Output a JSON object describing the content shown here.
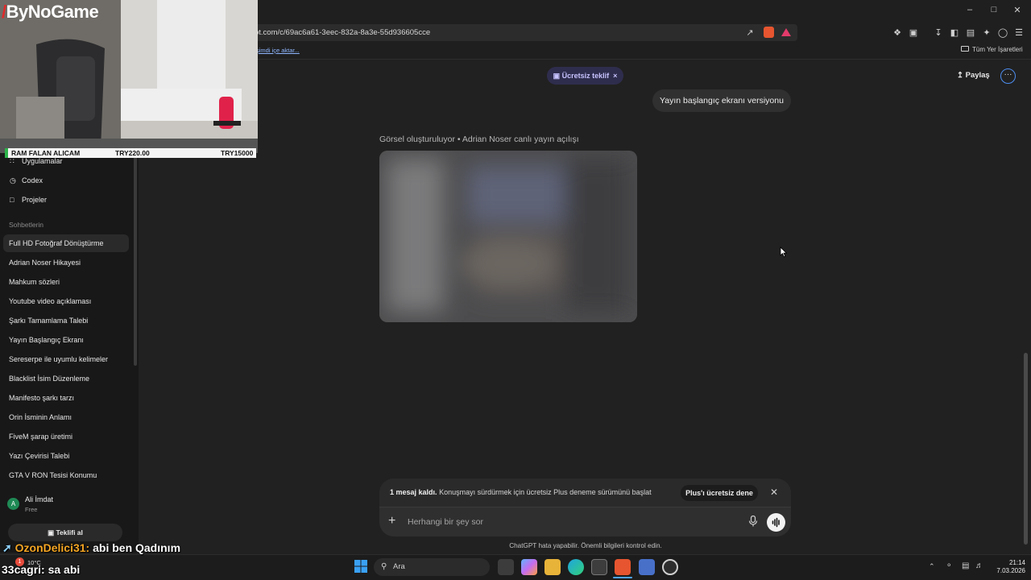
{
  "browser": {
    "url": "pt.com/c/69ac6a61-3eec-832a-8a3e-55d936605cce",
    "bookmark_import": "şimdi içe aktar...",
    "bookmarks_all": "Tüm Yer İşaretleri"
  },
  "webcam_overlay": {
    "brand": "ByNoGame",
    "ticker": {
      "label": "RAM FALAN ALICAM",
      "current": "TRY220.00",
      "goal": "TRY15000"
    }
  },
  "sidebar": {
    "nav": [
      {
        "label": "Uygulamalar",
        "icon": "apps-icon"
      },
      {
        "label": "Codex",
        "icon": "codex-icon"
      },
      {
        "label": "Projeler",
        "icon": "folder-icon"
      }
    ],
    "chats_heading": "Sohbetlerin",
    "chats": [
      "Full HD Fotoğraf Dönüştürme",
      "Adrian Noser Hikayesi",
      "Mahkum sözleri",
      "Youtube video açıklaması",
      "Şarkı Tamamlama Talebi",
      "Yayın Başlangıç Ekranı",
      "Sereserpe ile uyumlu kelimeler",
      "Blacklist İsim Düzenleme",
      "Manifesto şarkı tarzı",
      "Orin İsminin Anlamı",
      "FiveM şarap üretimi",
      "Yazı Çevirisi Talebi",
      "GTA V RON Tesisi Konumu"
    ],
    "active_chat_index": 0,
    "user": {
      "initial": "A",
      "name": "Ali İmdat",
      "plan": "Free"
    },
    "offer_button": "Teklifi al"
  },
  "header": {
    "offer_pill": "Ücretsiz teklif",
    "share": "Paylaş"
  },
  "conversation": {
    "user_message": "Yayın başlangıç ekranı versiyonu",
    "status": "Görsel oluşturuluyor • Adrian Noser canlı yayın açılışı"
  },
  "composer": {
    "limit_bold": "1 mesaj kaldı.",
    "limit_text": "Konuşmayı sürdürmek için ücretsiz Plus deneme sürümünü başlat",
    "trial_button": "Plus'ı ücretsiz dene",
    "placeholder": "Herhangi bir şey sor",
    "disclaimer": "ChatGPT hata yapabilir. Önemli bilgileri kontrol edin."
  },
  "stream_chat": [
    {
      "user": "OzonDelici31:",
      "message": "abi ben Qadınım"
    },
    {
      "user": "33cagri:",
      "message": "sa abi"
    }
  ],
  "taskbar": {
    "search": "Ara",
    "weather": "10°C",
    "weather_badge": "1",
    "time": "21:14",
    "date": "7.03.2026"
  }
}
